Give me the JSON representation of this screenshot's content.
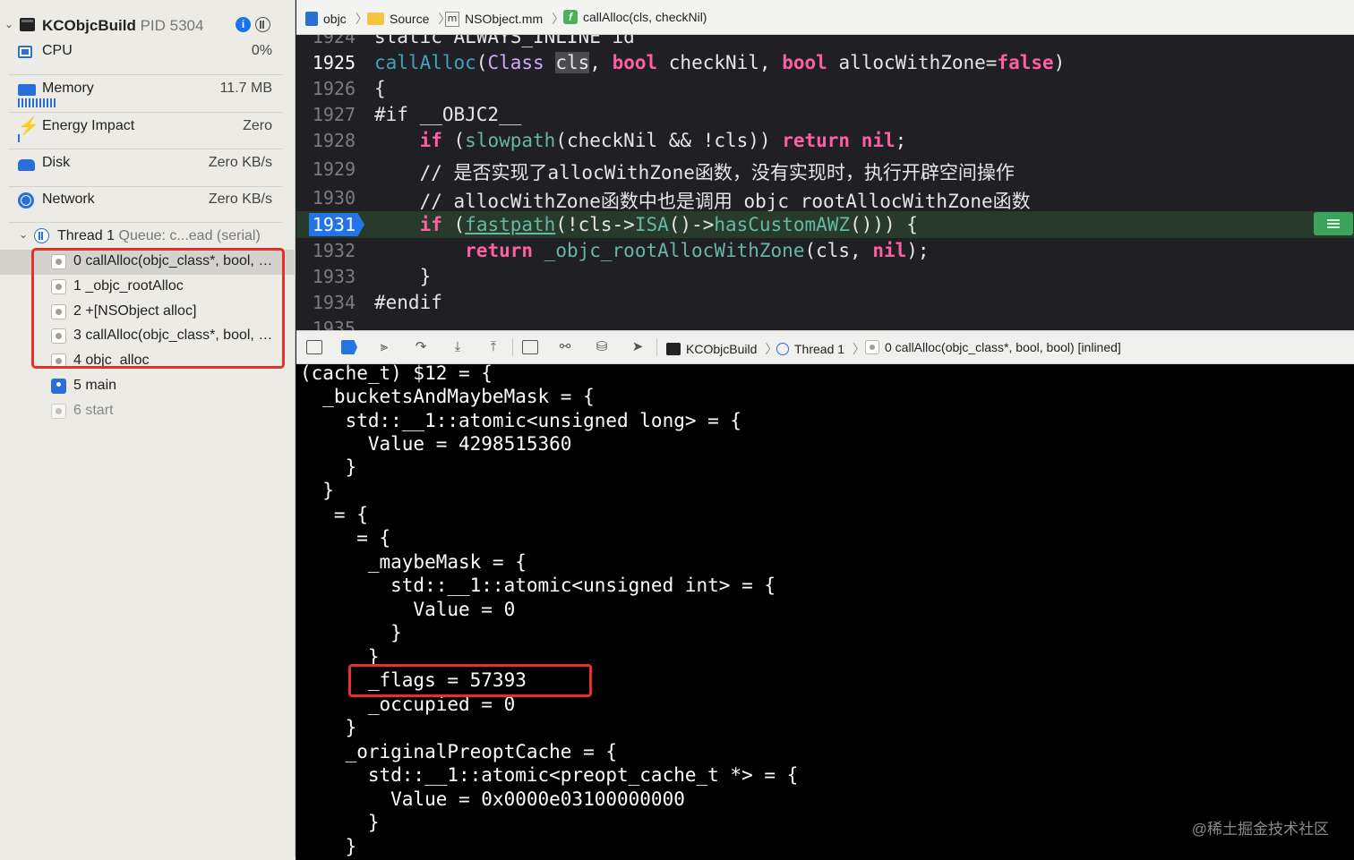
{
  "sidebar": {
    "process": {
      "name": "KCObjcBuild",
      "pid": "PID 5304",
      "info_glyph": "i"
    },
    "gauges": [
      {
        "label": "CPU",
        "value": "0%",
        "icon": "cpu-icon"
      },
      {
        "label": "Memory",
        "value": "11.7 MB",
        "icon": "memory-icon"
      },
      {
        "label": "Energy Impact",
        "value": "Zero",
        "icon": "bolt-icon"
      },
      {
        "label": "Disk",
        "value": "Zero KB/s",
        "icon": "disk-icon"
      },
      {
        "label": "Network",
        "value": "Zero KB/s",
        "icon": "globe-icon"
      }
    ],
    "thread": {
      "name": "Thread 1",
      "queue": "Queue: c...ead (serial)"
    },
    "frames": [
      {
        "label": "0 callAlloc(objc_class*, bool, bool)"
      },
      {
        "label": "1 _objc_rootAlloc"
      },
      {
        "label": "2 +[NSObject alloc]"
      },
      {
        "label": "3 callAlloc(objc_class*, bool, bool)"
      },
      {
        "label": "4 objc_alloc"
      },
      {
        "label": "5 main"
      },
      {
        "label": "6 start"
      }
    ]
  },
  "jumpbar": {
    "crumbs": [
      "objc",
      "Source",
      "NSObject.mm",
      "callAlloc(cls, checkNil)"
    ],
    "m_glyph": "m",
    "f_glyph": "f"
  },
  "editor": {
    "lines": [
      {
        "num": "1924",
        "code": "static ALWAYS_INLINE id"
      },
      {
        "num": "1925",
        "code": "callAlloc(Class cls, bool checkNil, bool allocWithZone=false)"
      },
      {
        "num": "1926",
        "code": "{"
      },
      {
        "num": "1927",
        "code": "#if __OBJC2__"
      },
      {
        "num": "1928",
        "code": "    if (slowpath(checkNil && !cls)) return nil;"
      },
      {
        "num": "1929",
        "code": "    // 是否实现了allocWithZone函数，没有实现时，执行开辟空间操作"
      },
      {
        "num": "1930",
        "code": "    // allocWithZone函数中也是调用_objc_rootAllocWithZone函数"
      },
      {
        "num": "1931",
        "code": "    if (fastpath(!cls->ISA()->hasCustomAWZ())) {"
      },
      {
        "num": "1932",
        "code": "        return _objc_rootAllocWithZone(cls, nil);"
      },
      {
        "num": "1933",
        "code": "    }"
      },
      {
        "num": "1934",
        "code": "#endif"
      },
      {
        "num": "1935",
        "code": ""
      }
    ]
  },
  "debugbar": {
    "crumbs": [
      "KCObjcBuild",
      "Thread 1",
      "0 callAlloc(objc_class*, bool, bool) [inlined]"
    ]
  },
  "console": {
    "lines": [
      "(cache_t) $12 = {",
      "  _bucketsAndMaybeMask = {",
      "    std::__1::atomic<unsigned long> = {",
      "      Value = 4298515360",
      "    }",
      "  }",
      "   = {",
      "     = {",
      "      _maybeMask = {",
      "        std::__1::atomic<unsigned int> = {",
      "          Value = 0",
      "        }",
      "      }",
      "      _flags = 57393",
      "      _occupied = 0",
      "    }",
      "    _originalPreoptCache = {",
      "      std::__1::atomic<preopt_cache_t *> = {",
      "        Value = 0x0000e03100000000",
      "      }",
      "    }"
    ]
  },
  "watermark": "@稀土掘金技术社区",
  "colors": {
    "highlight_box": "#e5312a",
    "accent": "#2574e6",
    "current_line": "#273a2b"
  }
}
